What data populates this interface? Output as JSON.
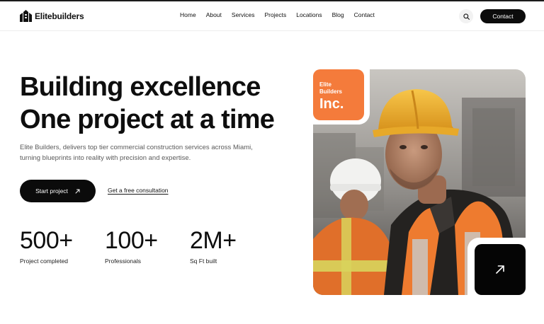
{
  "brand": {
    "name": "Elitebuilders",
    "logo_icon": "building-logo-icon"
  },
  "nav": [
    "Home",
    "About",
    "Services",
    "Projects",
    "Locations",
    "Blog",
    "Contact"
  ],
  "header": {
    "contact_label": "Contact",
    "search_icon": "search-icon"
  },
  "hero": {
    "headline_line1": "Building excellence",
    "headline_line2": "One project at a time",
    "description": "Elite Builders, delivers top tier commercial construction services across Miami, turning blueprints into reality with precision and expertise.",
    "primary_cta": "Start project",
    "secondary_cta": "Get a free consultation"
  },
  "stats": [
    {
      "value": "500+",
      "label": "Project completed"
    },
    {
      "value": "100+",
      "label": "Professionals"
    },
    {
      "value": "2M+",
      "label": "Sq Ft built"
    }
  ],
  "badge": {
    "line1": "Elite",
    "line2": "Builders",
    "line3": "Inc."
  },
  "colors": {
    "accent": "#F47B3B",
    "dark": "#0B0B0B"
  }
}
